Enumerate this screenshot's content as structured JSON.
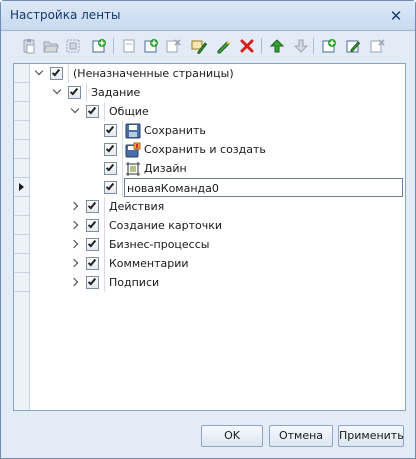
{
  "window": {
    "title": "Настройка ленты",
    "close_glyph": "✕"
  },
  "toolbar": {
    "buttons": [
      {
        "name": "paste-icon",
        "enabled": false
      },
      {
        "name": "folder-open-icon",
        "enabled": false
      },
      {
        "name": "grid-select-icon",
        "enabled": false
      },
      {
        "name": "add-group-icon",
        "enabled": true
      },
      {
        "name": "new-page-icon",
        "enabled": false
      },
      {
        "name": "add-page-icon",
        "enabled": true
      },
      {
        "name": "remove-page-icon",
        "enabled": false
      },
      {
        "name": "rename-icon",
        "enabled": true
      },
      {
        "name": "edit-pencil-icon",
        "enabled": true
      },
      {
        "name": "delete-icon",
        "enabled": true
      },
      {
        "name": "move-up-icon",
        "enabled": true
      },
      {
        "name": "move-down-icon",
        "enabled": false
      },
      {
        "name": "add-command-icon",
        "enabled": true
      },
      {
        "name": "edit-command-icon",
        "enabled": true
      },
      {
        "name": "remove-command-icon",
        "enabled": false
      }
    ]
  },
  "tree": {
    "rows": [
      {
        "label": "(Неназначенные страницы)",
        "level": 0,
        "expanded": true,
        "checked": true,
        "icon": null
      },
      {
        "label": "Задание",
        "level": 1,
        "expanded": true,
        "checked": true,
        "icon": null
      },
      {
        "label": "Общие",
        "level": 2,
        "expanded": true,
        "checked": true,
        "icon": null
      },
      {
        "label": "Сохранить",
        "level": 3,
        "expanded": null,
        "checked": true,
        "icon": "save-icon"
      },
      {
        "label": "Сохранить и создать",
        "level": 3,
        "expanded": null,
        "checked": true,
        "icon": "save-and-create-icon"
      },
      {
        "label": "Дизайн",
        "level": 3,
        "expanded": null,
        "checked": true,
        "icon": "design-icon"
      },
      {
        "label": "новаяКоманда0",
        "level": 3,
        "expanded": null,
        "checked": true,
        "icon": null,
        "editing": true,
        "current": true
      },
      {
        "label": "Действия",
        "level": 2,
        "expanded": false,
        "checked": true,
        "icon": null
      },
      {
        "label": "Создание карточки",
        "level": 2,
        "expanded": false,
        "checked": true,
        "icon": null
      },
      {
        "label": "Бизнес-процессы",
        "level": 2,
        "expanded": false,
        "checked": true,
        "icon": null
      },
      {
        "label": "Комментарии",
        "level": 2,
        "expanded": false,
        "checked": true,
        "icon": null
      },
      {
        "label": "Подписи",
        "level": 2,
        "expanded": false,
        "checked": true,
        "icon": null
      }
    ]
  },
  "buttons": {
    "ok": "OK",
    "cancel": "Отмена",
    "apply": "Применить"
  },
  "colors": {
    "window_bg": "#e2ebf6",
    "border": "#8aa4c8",
    "title_text": "#15396a"
  }
}
